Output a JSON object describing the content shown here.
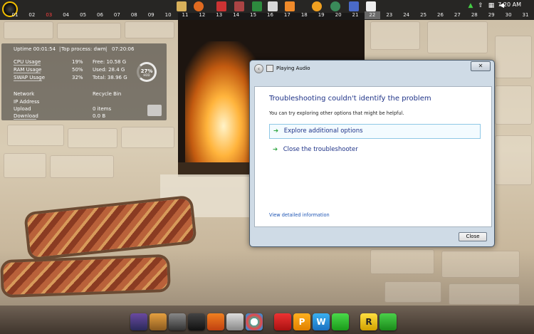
{
  "calendar": {
    "days": [
      "01",
      "02",
      "03",
      "04",
      "05",
      "06",
      "07",
      "08",
      "09",
      "10",
      "11",
      "12",
      "13",
      "14",
      "15",
      "16",
      "17",
      "18",
      "19",
      "20",
      "21",
      "22",
      "23",
      "24",
      "25",
      "26",
      "27",
      "28",
      "29",
      "30",
      "31"
    ],
    "today": "22",
    "weekend_color": "#ff4040",
    "tray_icons": [
      "triangle-flag-icon",
      "arrow-up-icon",
      "network-icon",
      "speaker-icon"
    ],
    "clock": "7:20 AM"
  },
  "sysmon": {
    "uptime": "Uptime 00:01:54",
    "top_process": "Top process: dwm",
    "time": "07:20:06",
    "cpu_label": "CPU Usage",
    "cpu_value": "19%",
    "ram_label": "RAM Usage",
    "ram_value": "50%",
    "swap_label": "SWAP Usage",
    "swap_value": "32%",
    "free": "Free: 10.58 G",
    "used": "Used: 28.4 G",
    "total": "Total:   38.96 G",
    "gauge_pct": "27%",
    "gauge_label": "HDD",
    "network": "Network",
    "ip": "IP Address",
    "upload": "Upload",
    "download": "Download",
    "recycle": "Recycle Bin",
    "items": "0 items",
    "size": "0.0 B"
  },
  "dialog": {
    "title": "Playing Audio",
    "heading": "Troubleshooting couldn't identify the problem",
    "subtext": "You can try exploring other options that might be helpful.",
    "options": [
      "Explore additional options",
      "Close the troubleshooter"
    ],
    "detail_link": "View detailed information",
    "close_button": "Close",
    "close_glyph": "✕",
    "back_glyph": "‹",
    "accent": "#1e3287"
  },
  "dock": {
    "icons": [
      "ipod-icon",
      "books-icon",
      "gauge-icon",
      "calculator-icon",
      "vlc-icon",
      "rocket-icon",
      "picasa-icon",
      "pdf-icon",
      "powerpoint-icon",
      "windows-live-icon",
      "phone-icon",
      "registry-icon",
      "recycle-icon"
    ],
    "letters": [
      "",
      "",
      "",
      "",
      "",
      "",
      "",
      "",
      "P",
      "W",
      "",
      "R",
      ""
    ]
  }
}
